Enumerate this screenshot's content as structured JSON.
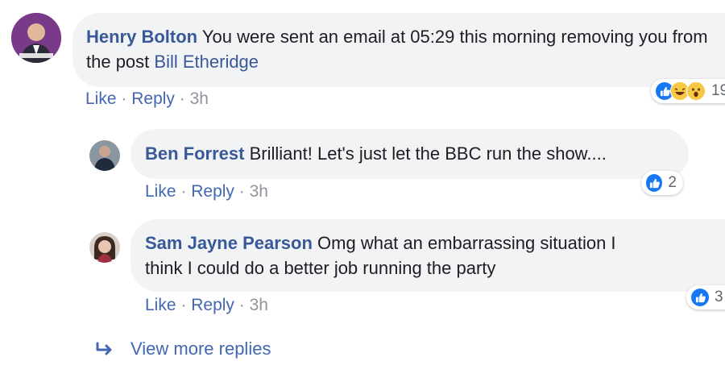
{
  "comments": [
    {
      "author": "Henry Bolton",
      "text": "You were sent an email at 05:29 this morning removing you from the post",
      "mention": "Bill Etheridge",
      "like": "Like",
      "reply": "Reply",
      "time": "3h",
      "reaction_count": "19"
    },
    {
      "author": "Ben Forrest",
      "text": "Brilliant! Let's just let the BBC run the show....",
      "like": "Like",
      "reply": "Reply",
      "time": "3h",
      "reaction_count": "2"
    },
    {
      "author": "Sam Jayne Pearson",
      "text_line1": "Omg what an embarrassing situation I",
      "text_line2": "think I could do a better job running the party",
      "like": "Like",
      "reply": "Reply",
      "time": "3h",
      "reaction_count": "3"
    }
  ],
  "view_more": "View more replies",
  "separator": "·",
  "icons": {
    "like": "thumbs-up-icon",
    "haha": "laughing-emoji-icon",
    "wow": "wow-emoji-icon",
    "reply_arrow": "reply-arrow-icon"
  },
  "colors": {
    "link": "#385898",
    "action": "#4267b2",
    "like_blue": "#1877f2",
    "bubble": "#f2f3f5"
  }
}
